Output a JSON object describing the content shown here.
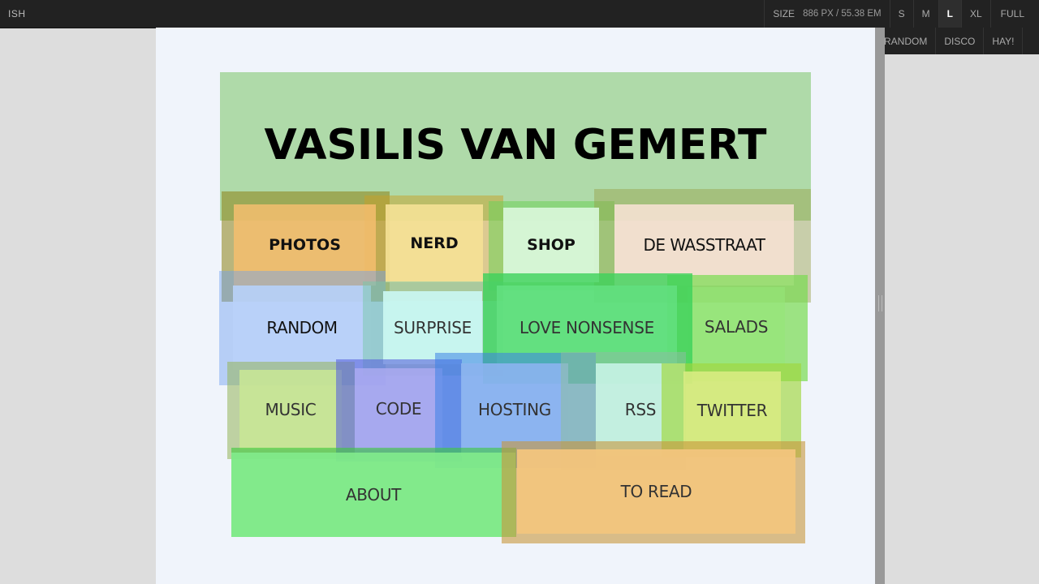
{
  "toolbar": {
    "logo": "ISH",
    "size_label": "SIZE",
    "size_value": "886 PX / 55.38 EM",
    "sizes": [
      "S",
      "M",
      "L",
      "XL",
      "FULL"
    ],
    "active_size": "L"
  },
  "dropdown": {
    "items": [
      "RANDOM",
      "DISCO",
      "HAY!"
    ]
  },
  "page": {
    "title": "VASILIS VAN GEMERT",
    "links": {
      "photos": "PHOTOS",
      "nerd": "NERD",
      "shop": "SHOP",
      "wasstraat": "DE WASSTRAAT",
      "random": "RANDOM",
      "surprise": "SURPRISE",
      "love": "LOVE NONSENSE",
      "salads": "SALADS",
      "music": "MUSIC",
      "code": "CODE",
      "hosting": "HOSTING",
      "rss": "RSS",
      "twitter": "TWITTER",
      "about": "ABOUT",
      "toread": "TO READ"
    }
  },
  "colors": {
    "topbar": "#222222",
    "viewport_bg": "#f0f4fb",
    "green": "#8ccd7d",
    "orange": "#f0b760",
    "blue": "#8fb2f0",
    "bright_green": "#5ed86a"
  }
}
